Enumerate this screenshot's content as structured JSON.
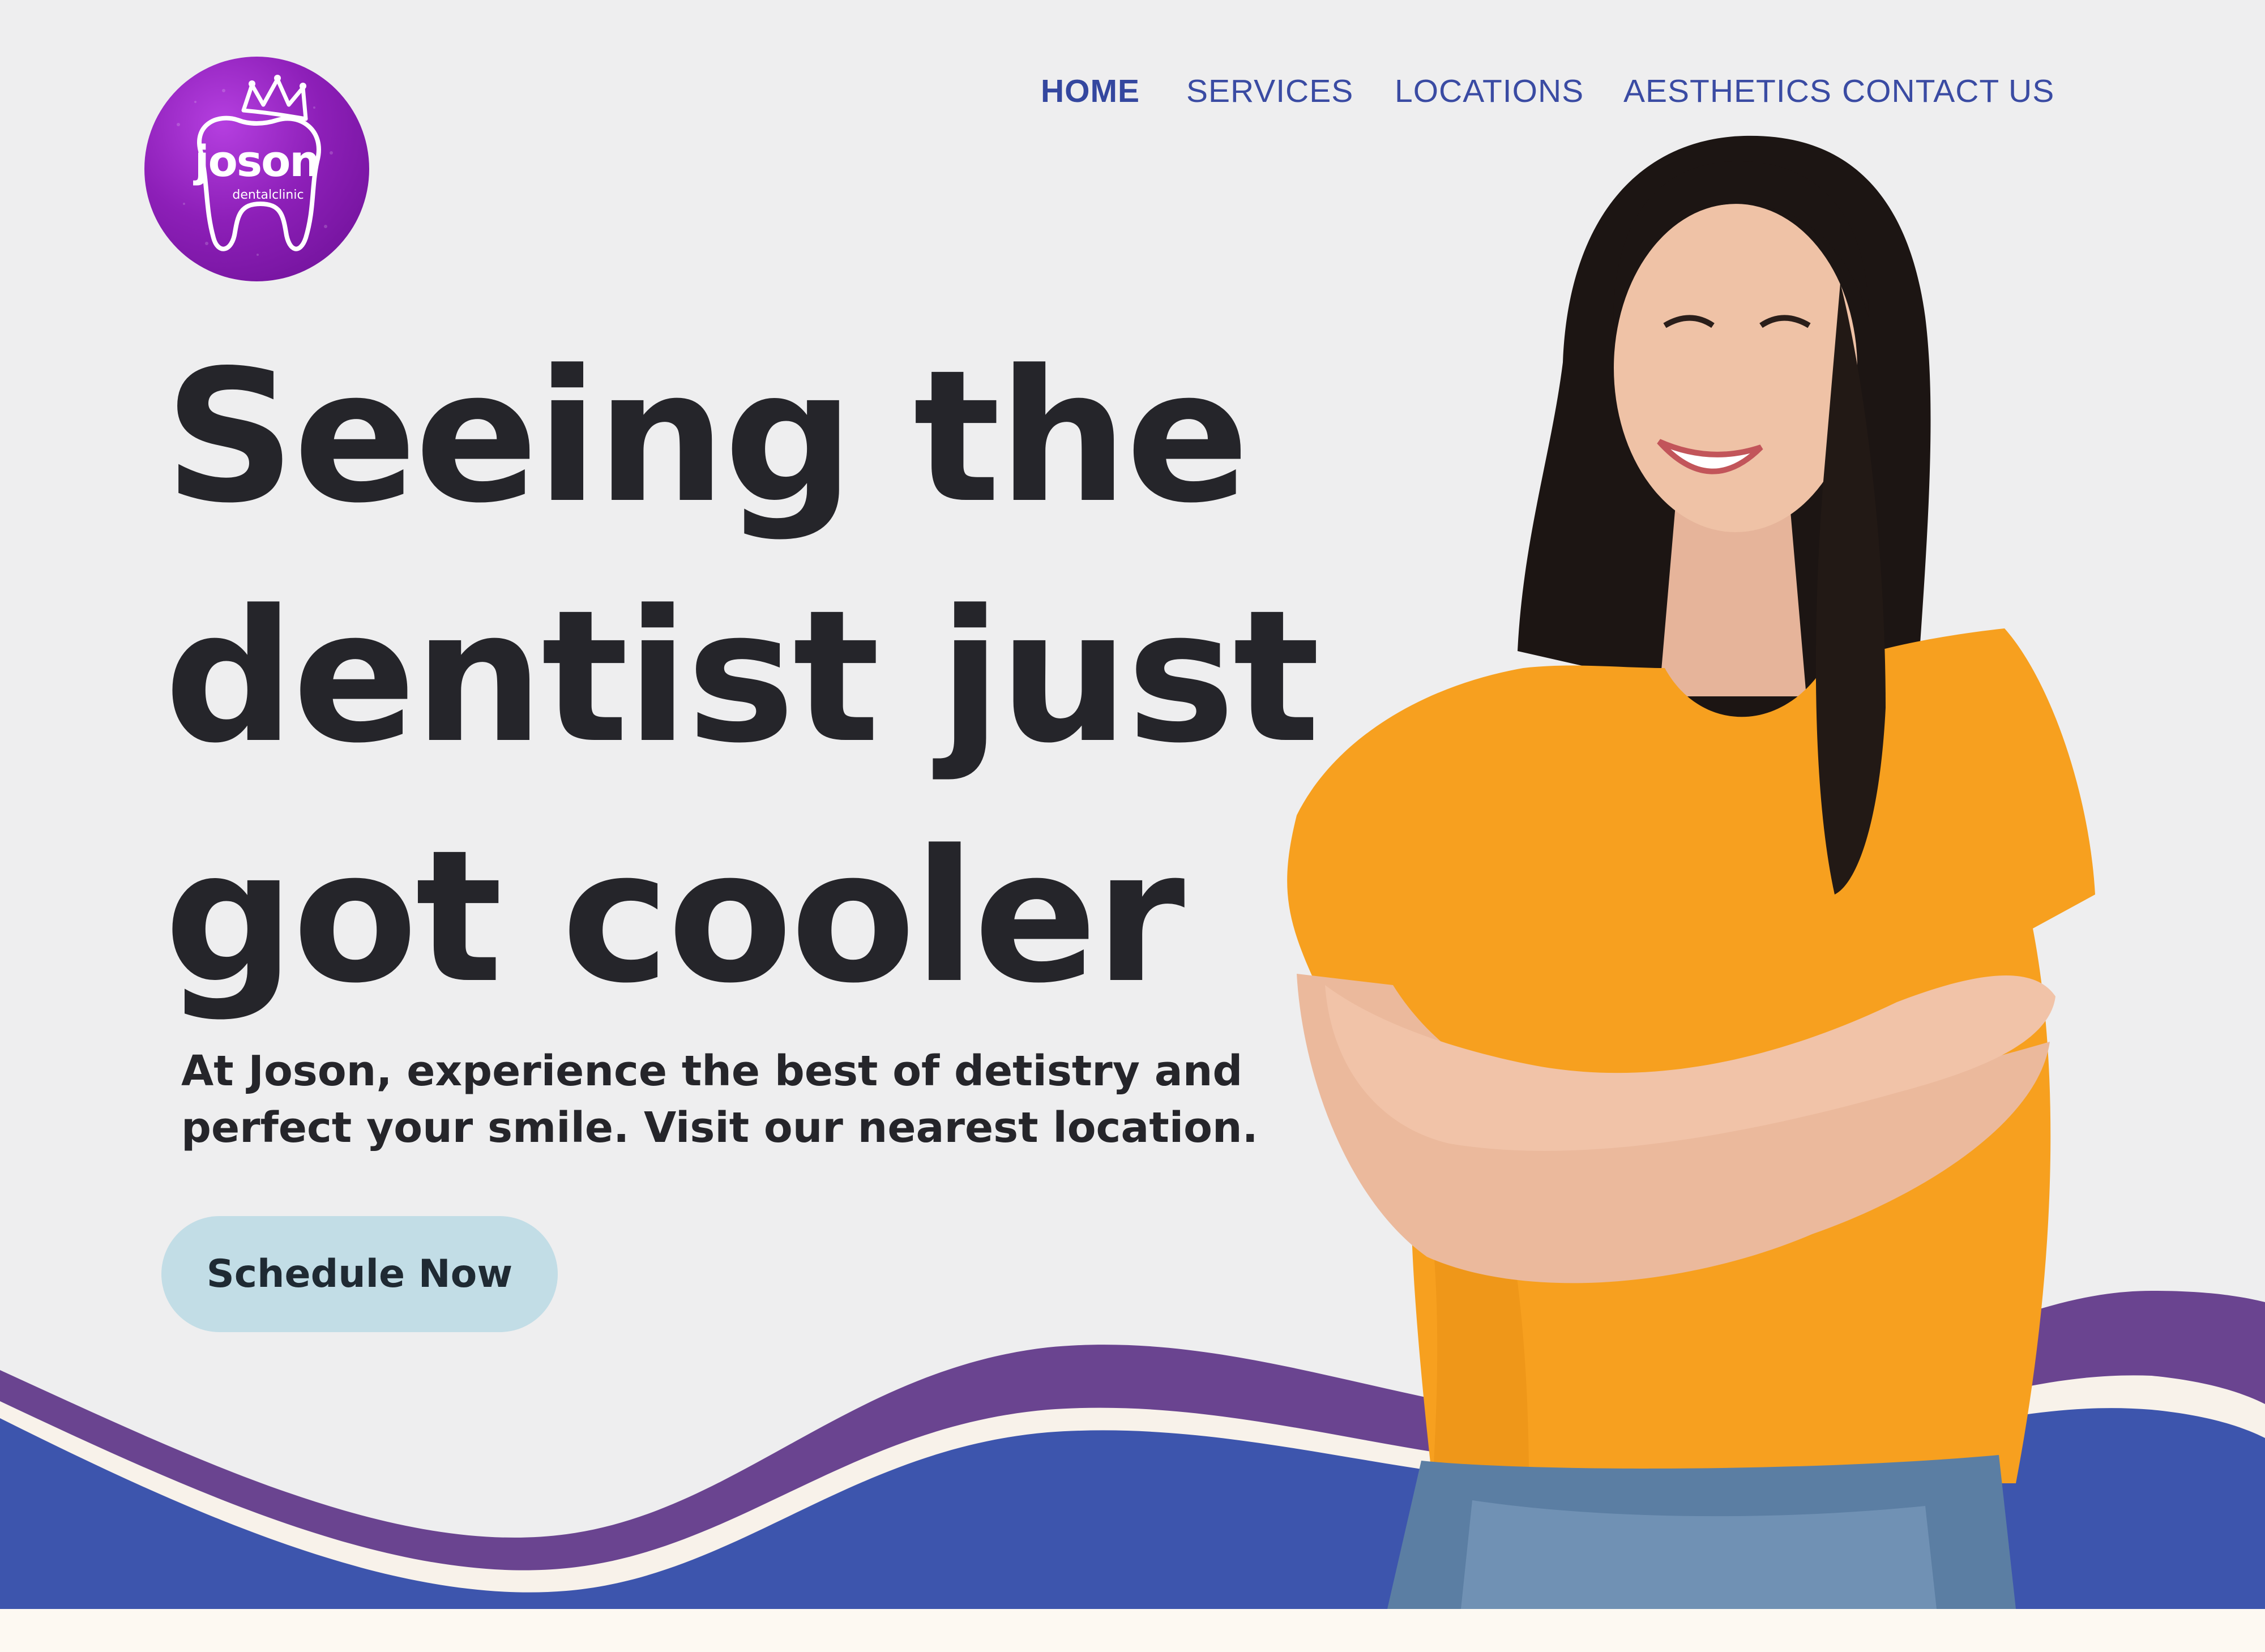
{
  "brand": {
    "name": "joson",
    "tagline": "dentalclinic",
    "colors": {
      "logo_purple": "#8d1fb8",
      "nav_blue": "#3a4ba3",
      "wave_purple": "#6a4490",
      "wave_blue": "#3d55ad",
      "wave_cream": "#f8f2ea",
      "cta_bg": "#c2dde6",
      "text_dark": "#25252a",
      "shirt_orange": "#f7a01f"
    }
  },
  "nav": {
    "items": [
      {
        "label": "HOME",
        "active": true
      },
      {
        "label": "SERVICES",
        "active": false
      },
      {
        "label": "LOCATIONS",
        "active": false
      },
      {
        "label": "AESTHETICS",
        "active": false
      },
      {
        "label": "CONTACT US",
        "active": false
      }
    ]
  },
  "hero": {
    "headline_lines": [
      "Seeing the",
      "dentist just",
      "got cooler"
    ],
    "subtext_lines": [
      "At Joson, experience the best of detistry and",
      "perfect your smile. Visit our nearest location."
    ],
    "cta_label": "Schedule Now"
  },
  "icons": {
    "logo_mark": "tooth-crown-icon"
  }
}
